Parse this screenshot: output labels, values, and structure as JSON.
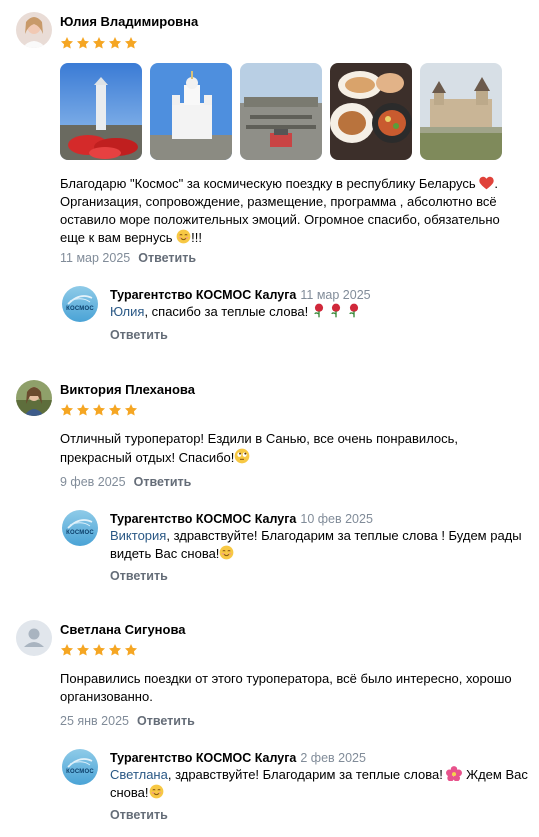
{
  "reviews": [
    {
      "author": "Юлия Владимировна",
      "rating": 5,
      "text": "Благодарю \"Космос\" за космическую поездку в республику Беларусь",
      "text_end": ". Организация, сопровождение, размещение, программа , абсолютно всё оставило море положительных эмоций. Огромное спасибо, обязательно еще к вам вернусь",
      "text_tail": "!!!",
      "date": "11 мар 2025",
      "reply_label": "Ответить",
      "photos": [
        "photo-memorial",
        "photo-church",
        "photo-cemetery",
        "photo-food",
        "photo-castle"
      ],
      "answer": {
        "author": "Турагентство КОСМОС Калуга",
        "date": "11 мар 2025",
        "mention": "Юлия",
        "text": ", спасибо за теплые слова!",
        "reply_label": "Ответить",
        "logo_text": "КОСМОС"
      }
    },
    {
      "author": "Виктория Плеханова",
      "rating": 5,
      "text": "Отличный туроператор! Ездили в Санью, все очень понравилось, прекрасный отдых! Спасибо!",
      "date": "9 фев 2025",
      "reply_label": "Ответить",
      "answer": {
        "author": "Турагентство КОСМОС Калуга",
        "date": "10 фев 2025",
        "mention": "Виктория",
        "text": ", здравствуйте! Благодарим за теплые слова ! Будем рады видеть Вас снова!",
        "reply_label": "Ответить",
        "logo_text": "КОСМОС"
      }
    },
    {
      "author": "Светлана Сигунова",
      "rating": 5,
      "text": "Понравились поездки от этого туроператора, всё было интересно, хорошо организованно.",
      "date": "25 янв 2025",
      "reply_label": "Ответить",
      "answer": {
        "author": "Турагентство КОСМОС Калуга",
        "date": "2 фев 2025",
        "mention": "Светлана",
        "text": ", здравствуйте! Благодарим за теплые слова!",
        "text_end": "Ждем Вас снова!",
        "reply_label": "Ответить",
        "logo_text": "КОСМОС"
      }
    }
  ],
  "colors": {
    "star": "#f5a623",
    "mention": "#2a5885",
    "meta": "#818c99",
    "reply": "#656d78"
  }
}
